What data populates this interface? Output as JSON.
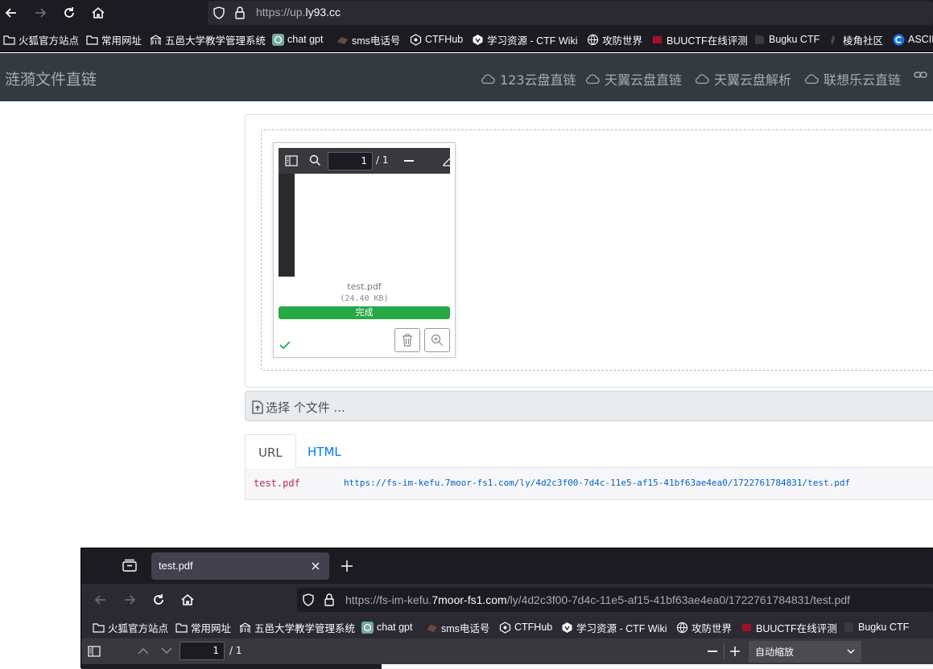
{
  "browser": {
    "url_prefix": "https://up.",
    "url_domain": "ly93.cc",
    "bookmarks": [
      "火狐官方站点",
      "常用网址",
      "五邑大学教学管理系统",
      "chat gpt",
      "sms电话号",
      "CTFHub",
      "学习资源 - CTF Wiki",
      "攻防世界",
      "BUUCTF在线评测",
      "Bugku CTF",
      "棱角社区",
      "ASCII"
    ]
  },
  "site": {
    "brand": "涟漪文件直链",
    "nav": [
      "123云盘直链",
      "天翼云盘直链",
      "天翼云盘解析",
      "联想乐云直链"
    ]
  },
  "preview": {
    "page_number": "1",
    "page_total": "/ 1",
    "file_name": "test.pdf",
    "file_size": "(24.40 KB)",
    "progress_label": "完成",
    "progress": 1.0
  },
  "file_input": {
    "label": "选择 个文件 ..."
  },
  "tabs": [
    "URL",
    "HTML"
  ],
  "result": {
    "name": "test.pdf",
    "url": "https://fs-im-kefu.7moor-fs1.com/ly/4d2c3f00-7d4c-11e5-af15-41bf63ae4ea0/1722761784831/test.pdf"
  },
  "window2": {
    "tab_title": "test.pdf",
    "url_prefix": "https://fs-im-kefu.",
    "url_domain": "7moor-fs1.com",
    "url_path": "/ly/4d2c3f00-7d4c-11e5-af15-41bf63ae4ea0/1722761784831/test.pdf",
    "bookmarks": [
      "火狐官方站点",
      "常用网址",
      "五邑大学教学管理系统",
      "chat gpt",
      "sms电话号",
      "CTFHub",
      "学习资源 - CTF Wiki",
      "攻防世界",
      "BUUCTF在线评测",
      "Bugku CTF"
    ],
    "page_number": "1",
    "page_total": "/ 1",
    "zoom_label": "自动缩放"
  }
}
